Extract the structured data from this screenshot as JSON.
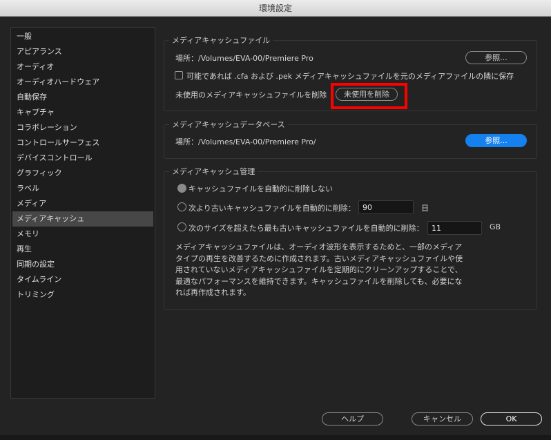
{
  "window": {
    "title": "環境設定"
  },
  "sidebar": {
    "items": [
      {
        "label": "一般"
      },
      {
        "label": "アピアランス"
      },
      {
        "label": "オーディオ"
      },
      {
        "label": "オーディオハードウェア"
      },
      {
        "label": "自動保存"
      },
      {
        "label": "キャプチャ"
      },
      {
        "label": "コラボレーション"
      },
      {
        "label": "コントロールサーフェス"
      },
      {
        "label": "デバイスコントロール"
      },
      {
        "label": "グラフィック"
      },
      {
        "label": "ラベル"
      },
      {
        "label": "メディア"
      },
      {
        "label": "メディアキャッシュ",
        "active": true
      },
      {
        "label": "メモリ"
      },
      {
        "label": "再生"
      },
      {
        "label": "同期の設定"
      },
      {
        "label": "タイムライン"
      },
      {
        "label": "トリミング"
      }
    ]
  },
  "cache_files": {
    "title": "メディアキャッシュファイル",
    "location": "場所：/Volumes/EVA-00/Premiere Pro",
    "browse": "参照...",
    "save_next_label": "可能であれば .cfa および .pek メディアキャッシュファイルを元のメディアファイルの隣に保存",
    "save_next_checked": false,
    "remove_unused_label": "未使用のメディアキャッシュファイルを削除",
    "remove_unused_button": "未使用を削除"
  },
  "cache_db": {
    "title": "メディアキャッシュデータベース",
    "location": "場所：/Volumes/EVA-00/Premiere Pro/",
    "browse": "参照..."
  },
  "cache_mgmt": {
    "title": "メディアキャッシュ管理",
    "opt_none": "キャッシュファイルを自動的に削除しない",
    "opt_age": "次より古いキャッシュファイルを自動的に削除：",
    "age_value": "90",
    "age_unit": "日",
    "opt_size": "次のサイズを超えたら最も古いキャッシュファイルを自動的に削除：",
    "size_value": "11",
    "size_unit": "GB",
    "selected": "none",
    "description": "メディアキャッシュファイルは、オーディオ波形を表示するためと、一部のメディアタイプの再生を改善するために作成されます。古いメディアキャッシュファイルや使用されていないメディアキャッシュファイルを定期的にクリーンアップすることで、最適なパフォーマンスを維持できます。キャッシュファイルを削除しても、必要になれば再作成されます。"
  },
  "footer": {
    "help": "ヘルプ",
    "cancel": "キャンセル",
    "ok": "OK"
  },
  "colors": {
    "accent": "#1581ee",
    "highlight": "#ff0000"
  }
}
